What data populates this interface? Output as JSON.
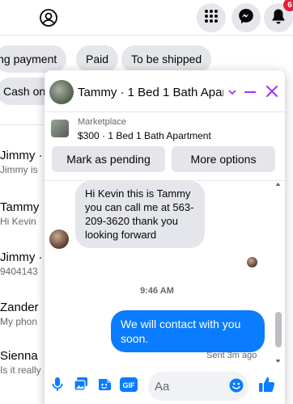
{
  "topbar": {
    "profile_icon": "profile-circle-icon",
    "menu_icon": "grid-menu-icon",
    "messenger_icon": "messenger-icon",
    "notifications_icon": "bell-icon",
    "notification_count": "6"
  },
  "filters": {
    "chips": [
      "ing payment",
      "Paid",
      "To be shipped"
    ],
    "cash_chip": "Cash on"
  },
  "conversations": [
    {
      "name": "Jimmy ·",
      "preview": "Jimmy is"
    },
    {
      "name": "Tammy",
      "preview": "Hi Kevin"
    },
    {
      "name": "Jimmy ·",
      "preview": "9404143"
    },
    {
      "name": "Zander",
      "preview": "My phon"
    },
    {
      "name": "Sienna",
      "preview": "Is it really"
    }
  ],
  "chat": {
    "title": "Tammy · 1 Bed 1 Bath Apar…",
    "marketplace_label": "Marketplace",
    "listing_title": "$300 · 1 Bed 1 Bath Apartment",
    "mark_pending_label": "Mark as pending",
    "more_options_label": "More options",
    "incoming_message": "Hi Kevin this is Tammy you can call me at 563-209-3620 thank you looking forward",
    "timestamp": "9:46 AM",
    "outgoing_message": "We will contact with you soon.",
    "sent_status": "Sent 3m ago",
    "input_placeholder": "Aa",
    "accent_color": "#a033ff",
    "bubble_color": "#0a7cff"
  }
}
